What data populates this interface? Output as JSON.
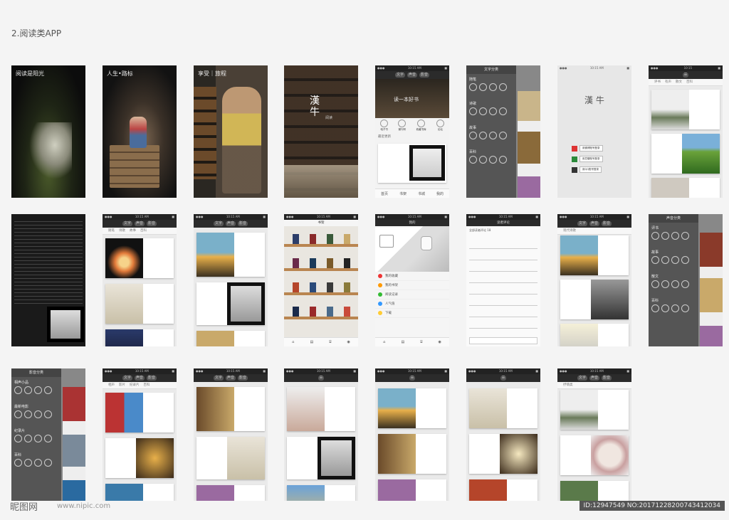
{
  "page": {
    "title": "2.阅读类APP"
  },
  "splash": [
    {
      "title": "阅读是阳光"
    },
    {
      "title": "人生•路标"
    },
    {
      "title": "享受｜旅程"
    }
  ],
  "logo": {
    "text": "漢 牛",
    "sub": "阅读"
  },
  "home": {
    "nav_tabs": [
      "文字",
      "声音",
      "影音"
    ],
    "banner_text": "读一本好书",
    "icons": [
      "电子书",
      "微刊号",
      "收藏书库",
      "论坛"
    ],
    "section": "最近更新",
    "tabbar": [
      "首页",
      "书架",
      "书城",
      "我的"
    ]
  },
  "category_menu": {
    "title": "文字分类",
    "sections": [
      "随笔",
      "诗歌",
      "故事",
      "百科"
    ]
  },
  "login": {
    "logo": "漢 牛",
    "buttons": [
      "用微博账号登录",
      "用豆瓣账号登录",
      "用QQ账号登录"
    ]
  },
  "list_tabs": {
    "a": [
      "评书",
      "有声",
      "散文",
      "百科"
    ],
    "b": [
      "随笔",
      "诗歌",
      "故事",
      "百科"
    ],
    "c": [
      "相声",
      "影片",
      "纪录片",
      "百科"
    ],
    "d": [
      "现代诗歌"
    ],
    "e": [
      "抒情类"
    ]
  },
  "bookshelf": {
    "title": "书架"
  },
  "profile": {
    "title": "我的",
    "rows": [
      "我的收藏",
      "我的书架",
      "阅读记录",
      "人气值",
      "下载"
    ]
  },
  "comments": {
    "title": "读者评论",
    "header": "全部读者评论 18"
  },
  "sound_menu": {
    "title": "声音分类",
    "sections": [
      "评书",
      "故事",
      "散文",
      "百科"
    ]
  },
  "video_menu": {
    "title": "影音分类",
    "sections": [
      "相声小品",
      "最新电影",
      "纪录片",
      "百科"
    ]
  },
  "footer": {
    "watermark": "昵图网",
    "url": "www.nipic.com",
    "id": "ID:12947549 NO:20171228200743412034"
  }
}
